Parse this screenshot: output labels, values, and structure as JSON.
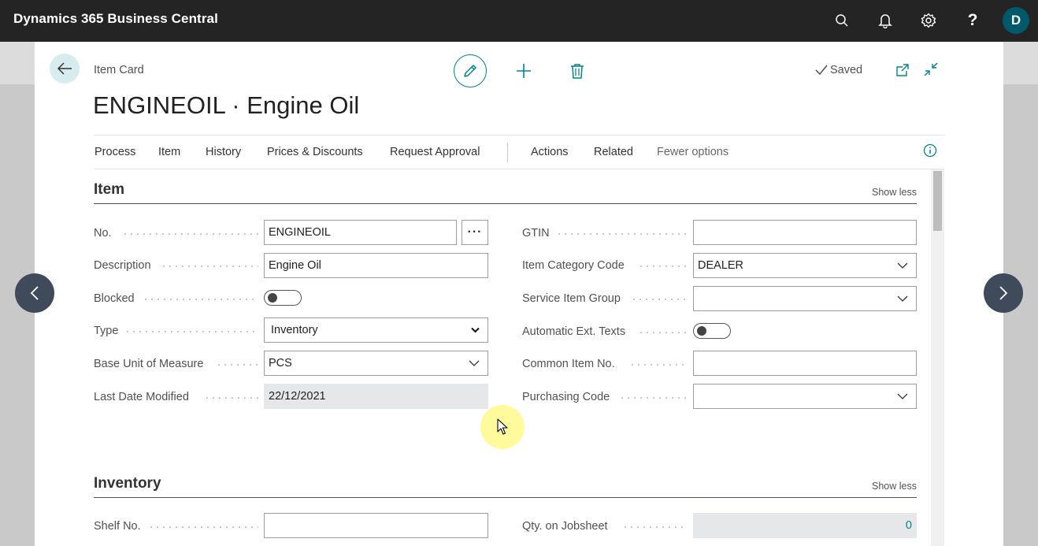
{
  "app": {
    "title": "Dynamics 365 Business Central",
    "user_initial": "D"
  },
  "page": {
    "caption": "Item Card",
    "title": "ENGINEOIL · Engine Oil",
    "status": "Saved"
  },
  "action_bar": {
    "items": [
      "Process",
      "Item",
      "History",
      "Prices & Discounts",
      "Request Approval",
      "Actions",
      "Related",
      "Fewer options"
    ]
  },
  "sections": {
    "item": {
      "title": "Item",
      "toggle": "Show less"
    },
    "inventory": {
      "title": "Inventory",
      "toggle": "Show less"
    }
  },
  "item_fields": {
    "no": {
      "label": "No.",
      "value": "ENGINEOIL"
    },
    "description": {
      "label": "Description",
      "value": "Engine Oil"
    },
    "blocked": {
      "label": "Blocked",
      "value": false
    },
    "type": {
      "label": "Type",
      "value": "Inventory"
    },
    "base_uom": {
      "label": "Base Unit of Measure",
      "value": "PCS"
    },
    "last_modified": {
      "label": "Last Date Modified",
      "value": "22/12/2021"
    },
    "gtin": {
      "label": "GTIN",
      "value": ""
    },
    "item_category": {
      "label": "Item Category Code",
      "value": "DEALER"
    },
    "service_group": {
      "label": "Service Item Group",
      "value": ""
    },
    "auto_ext_texts": {
      "label": "Automatic Ext. Texts",
      "value": false
    },
    "common_item_no": {
      "label": "Common Item No.",
      "value": ""
    },
    "purchasing_code": {
      "label": "Purchasing Code",
      "value": ""
    }
  },
  "inventory_fields": {
    "shelf_no": {
      "label": "Shelf No.",
      "value": ""
    },
    "qty_jobsheet": {
      "label": "Qty. on Jobsheet",
      "value": "0"
    }
  },
  "icons": {
    "top": [
      "search-icon",
      "bell-icon",
      "gear-icon",
      "help-icon"
    ],
    "header": [
      "back-arrow-icon",
      "pencil-icon",
      "plus-icon",
      "trash-icon",
      "checkmark-icon",
      "open-new-window-icon",
      "collapse-icon",
      "info-icon"
    ],
    "nav": [
      "chevron-left-icon",
      "chevron-right-icon"
    ]
  },
  "colors": {
    "accent": "#00838f",
    "topbar": "#242424",
    "avatar": "#00596b"
  }
}
